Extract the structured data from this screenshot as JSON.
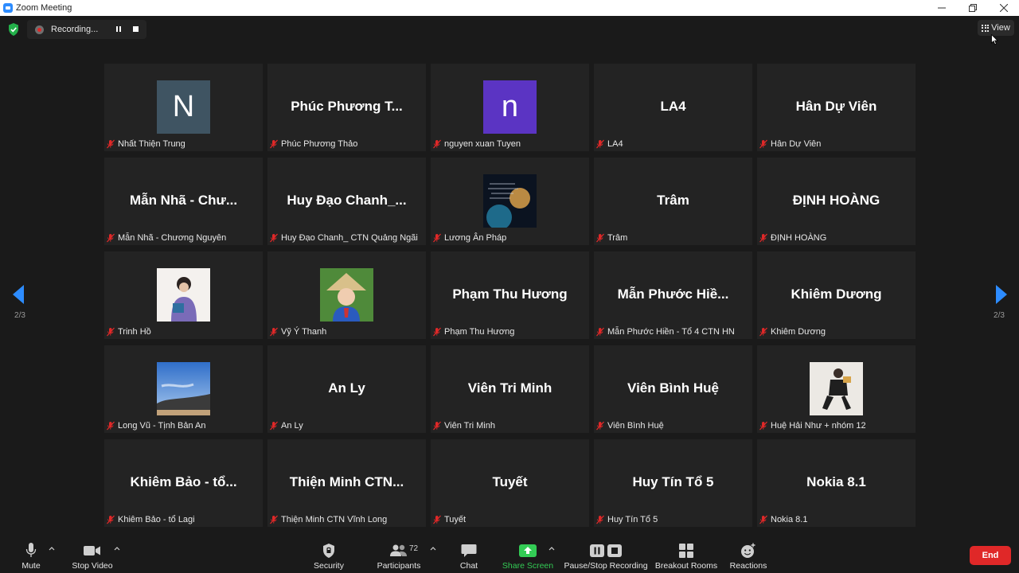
{
  "window": {
    "title": "Zoom Meeting"
  },
  "recording": {
    "status": "Recording..."
  },
  "view": {
    "label": "View"
  },
  "pager": {
    "left": "2/3",
    "right": "2/3"
  },
  "tiles": [
    {
      "display": "N",
      "label": "Nhất Thiện Trung",
      "avatar": "letter",
      "color": "#3f5462"
    },
    {
      "display": "Phúc Phương T...",
      "label": "Phúc Phương Thảo"
    },
    {
      "display": "n",
      "label": "nguyen xuan Tuyen",
      "avatar": "letter",
      "color": "#5b34c3"
    },
    {
      "display": "LA4",
      "label": "LA4"
    },
    {
      "display": "Hân Dự Viên",
      "label": "Hân Dự Viên"
    },
    {
      "display": "Mẫn Nhã - Chư...",
      "label": "Mẫn Nhã - Chương Nguyên"
    },
    {
      "display": "Huy Đạo Chanh_...",
      "label": "Huy Đạo Chanh_ CTN Quảng Ngãi"
    },
    {
      "display": "",
      "label": "Lương Ân Pháp",
      "avatar": "space"
    },
    {
      "display": "Trâm",
      "label": "Trâm"
    },
    {
      "display": "ĐỊNH HOÀNG",
      "label": "ĐỊNH HOÀNG"
    },
    {
      "display": "",
      "label": "Trinh Hồ",
      "avatar": "photo-girl"
    },
    {
      "display": "",
      "label": "Vỹ Ý Thanh",
      "avatar": "photo-hat"
    },
    {
      "display": "Phạm Thu Hương",
      "label": "Phạm Thu Hương"
    },
    {
      "display": "Mẫn Phước Hiề...",
      "label": "Mẫn Phước Hiền - Tổ 4 CTN HN"
    },
    {
      "display": "Khiêm Dương",
      "label": "Khiêm Dương"
    },
    {
      "display": "",
      "label": "Long Vũ - Tịnh Bản An",
      "avatar": "photo-sky"
    },
    {
      "display": "An Ly",
      "label": "An Ly"
    },
    {
      "display": "Viên Tri Minh",
      "label": "Viên Tri Minh"
    },
    {
      "display": "Viên Bình Huệ",
      "label": "Viên Bình Huệ"
    },
    {
      "display": "",
      "label": "Huệ Hải Như + nhóm 12",
      "avatar": "photo-person"
    },
    {
      "display": "Khiêm Bảo - tổ...",
      "label": "Khiêm Bảo - tổ Lagi"
    },
    {
      "display": "Thiện Minh CTN...",
      "label": "Thiện Minh CTN Vĩnh Long"
    },
    {
      "display": "Tuyết",
      "label": "Tuyết"
    },
    {
      "display": "Huy Tín Tổ 5",
      "label": "Huy Tín Tổ 5"
    },
    {
      "display": "Nokia 8.1",
      "label": "Nokia 8.1"
    }
  ],
  "toolbar": {
    "mute": "Mute",
    "stop_video": "Stop Video",
    "security": "Security",
    "participants": "Participants",
    "participants_count": "72",
    "chat": "Chat",
    "share_screen": "Share Screen",
    "recording": "Pause/Stop Recording",
    "breakout": "Breakout Rooms",
    "reactions": "Reactions",
    "end": "End"
  },
  "colors": {
    "accent_blue": "#2d8cff",
    "end_red": "#e02828",
    "share_green": "#33cc55",
    "mic_off_red": "#e02828"
  }
}
